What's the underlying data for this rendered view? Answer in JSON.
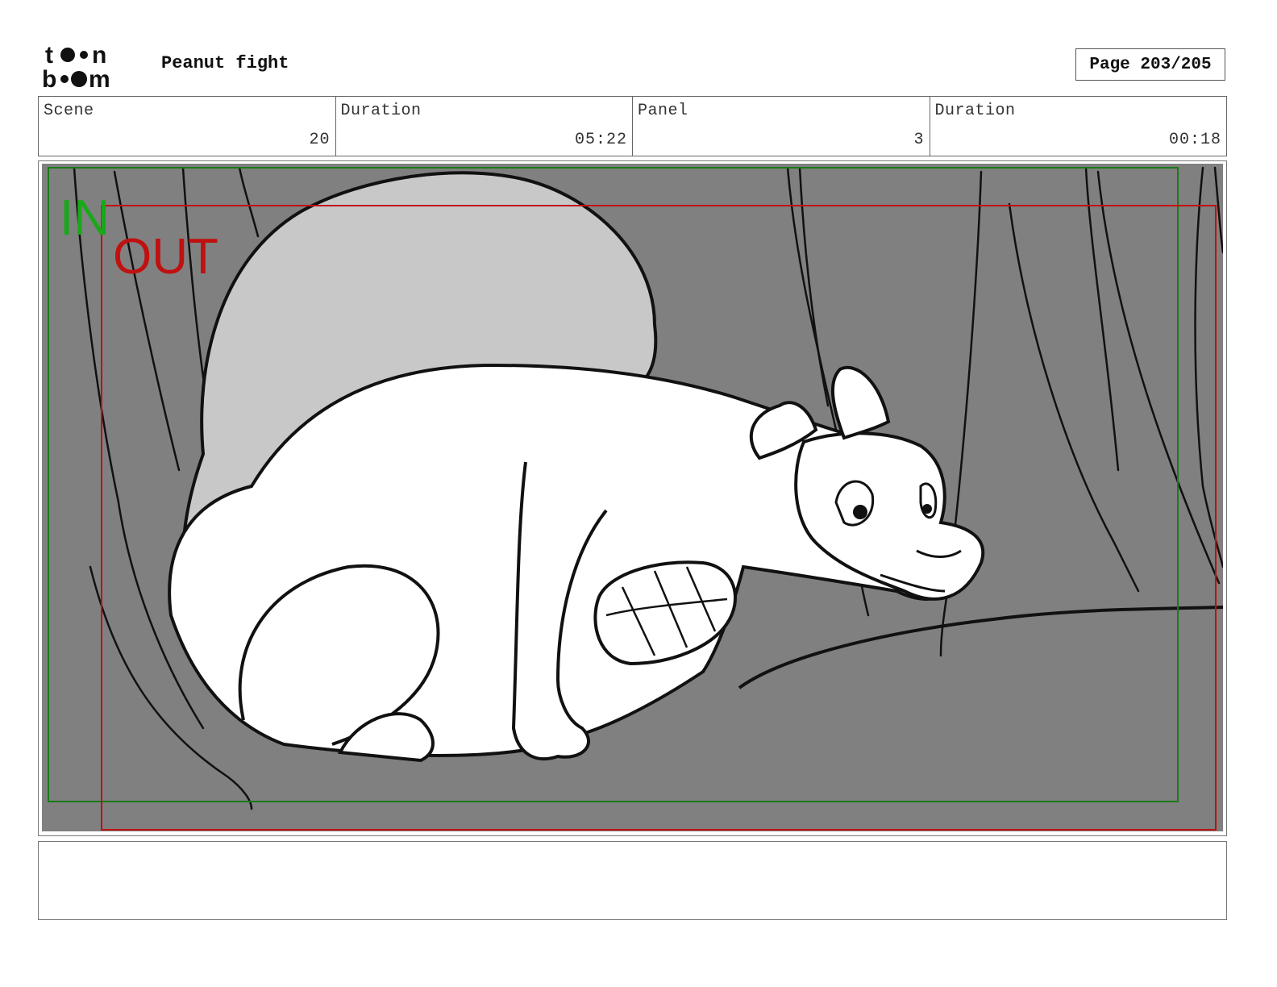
{
  "header": {
    "logo_text": "toon boom",
    "project_title": "Peanut fight",
    "page_label": "Page 203/205"
  },
  "info": {
    "scene_label": "Scene",
    "scene_value": "20",
    "scene_duration_label": "Duration",
    "scene_duration_value": "05:22",
    "panel_label": "Panel",
    "panel_value": "3",
    "panel_duration_label": "Duration",
    "panel_duration_value": "00:18"
  },
  "panel": {
    "in_marker": "IN",
    "out_marker": "OUT",
    "in_color": "#1aa81a",
    "out_color": "#c01010",
    "background_color": "#808080"
  },
  "notes": {
    "text": ""
  }
}
